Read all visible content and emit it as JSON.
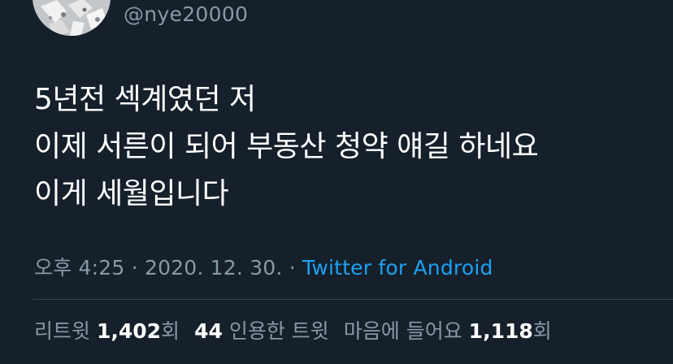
{
  "author": {
    "handle": "@nye20000"
  },
  "tweet": {
    "lines": [
      "5년전 섹계였던 저",
      "이제 서른이 되어 부동산 청약 얘길 하네요",
      "이게 세월입니다"
    ]
  },
  "meta": {
    "time": "오후 4:25",
    "separator": "·",
    "date": "2020. 12. 30.",
    "source": "Twitter for Android"
  },
  "stats": {
    "retweets_label": "리트윗",
    "retweets_count": "1,402",
    "retweets_suffix": "회",
    "quotes_count": "44",
    "quotes_label": "인용한 트윗",
    "likes_label": "마음에 들어요",
    "likes_count": "1,118",
    "likes_suffix": "회"
  },
  "colors": {
    "background": "#15202b",
    "secondary_text": "#8899a6",
    "link": "#1da1f2"
  }
}
